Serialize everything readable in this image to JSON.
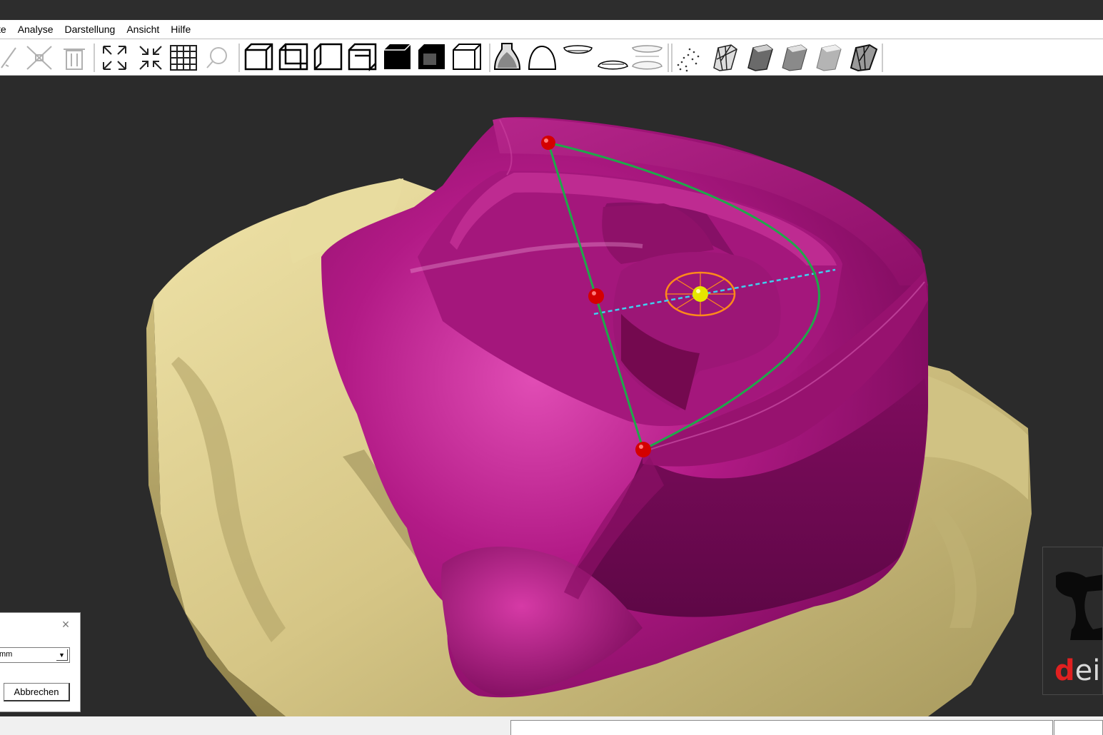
{
  "menu": {
    "items": [
      "te",
      "Analyse",
      "Darstellung",
      "Ansicht",
      "Hilfe"
    ]
  },
  "toolbar": {
    "groups": [
      [
        "measure-icon",
        "measure-delete-icon",
        "trash-icon"
      ],
      [
        "zoom-expand-icon",
        "zoom-shrink-icon",
        "grid-icon",
        "magnifier-icon"
      ],
      [
        "view-front-icon",
        "view-back-icon",
        "view-left-icon",
        "view-right-icon",
        "view-top-icon",
        "view-bottom-icon",
        "view-iso-icon"
      ],
      [
        "die-icon",
        "crown-outline-icon",
        "upper-jaw-icon",
        "lower-jaw-icon",
        "bite-icon"
      ],
      [
        "point-cloud-icon",
        "mesh-model-icon",
        "model-shaded-1-icon",
        "model-shaded-2-icon",
        "model-shaded-3-icon",
        "model-wire-icon"
      ]
    ]
  },
  "dialog": {
    "select_value": "mm",
    "cancel_label": "Abbrechen"
  },
  "logo": {
    "text_red": "d",
    "text_rest": "ei e"
  },
  "colors": {
    "background": "#2b2b2b",
    "model_magenta": "#a3137a",
    "die_beige": "#d9cc93",
    "curve_green": "#1fa84a",
    "axis_cyan": "#3fd0ef",
    "control_point_red": "#d40000",
    "center_point_yellow": "#e6e600",
    "ring_orange": "#ff8a1a"
  }
}
